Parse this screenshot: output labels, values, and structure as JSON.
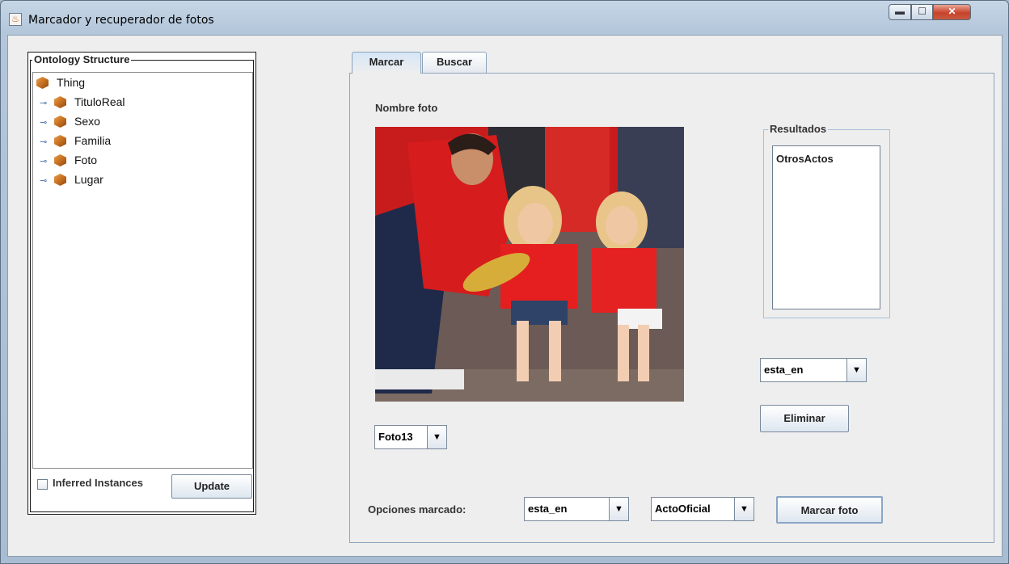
{
  "window": {
    "title": "Marcador y recuperador de fotos"
  },
  "ontology": {
    "legend": "Ontology Structure",
    "tree": [
      {
        "label": "Thing",
        "icon": "class-cube-icon",
        "expandable": false
      },
      {
        "label": "TituloReal",
        "icon": "class-cube-icon",
        "expandable": true
      },
      {
        "label": "Sexo",
        "icon": "class-cube-icon",
        "expandable": true
      },
      {
        "label": "Familia",
        "icon": "class-cube-icon",
        "expandable": true
      },
      {
        "label": "Foto",
        "icon": "class-cube-icon",
        "expandable": true
      },
      {
        "label": "Lugar",
        "icon": "class-cube-icon",
        "expandable": true
      }
    ],
    "inferred_label": "Inferred Instances",
    "inferred_checked": false,
    "update_label": "Update"
  },
  "tabs": [
    {
      "label": "Marcar",
      "active": true
    },
    {
      "label": "Buscar",
      "active": false
    }
  ],
  "marcar": {
    "photo_name_label": "Nombre foto",
    "photo_select": "Foto13",
    "results_legend": "Resultados",
    "results": [
      "OtrosActos"
    ],
    "relation_select": "esta_en",
    "delete_label": "Eliminar",
    "options_label": "Opciones marcado:",
    "option_property": "esta_en",
    "option_class": "ActoOficial",
    "mark_label": "Marcar foto"
  },
  "colors": {
    "accent": "#8da4bd",
    "panel": "#eeeeee",
    "cube": "#c87020"
  }
}
